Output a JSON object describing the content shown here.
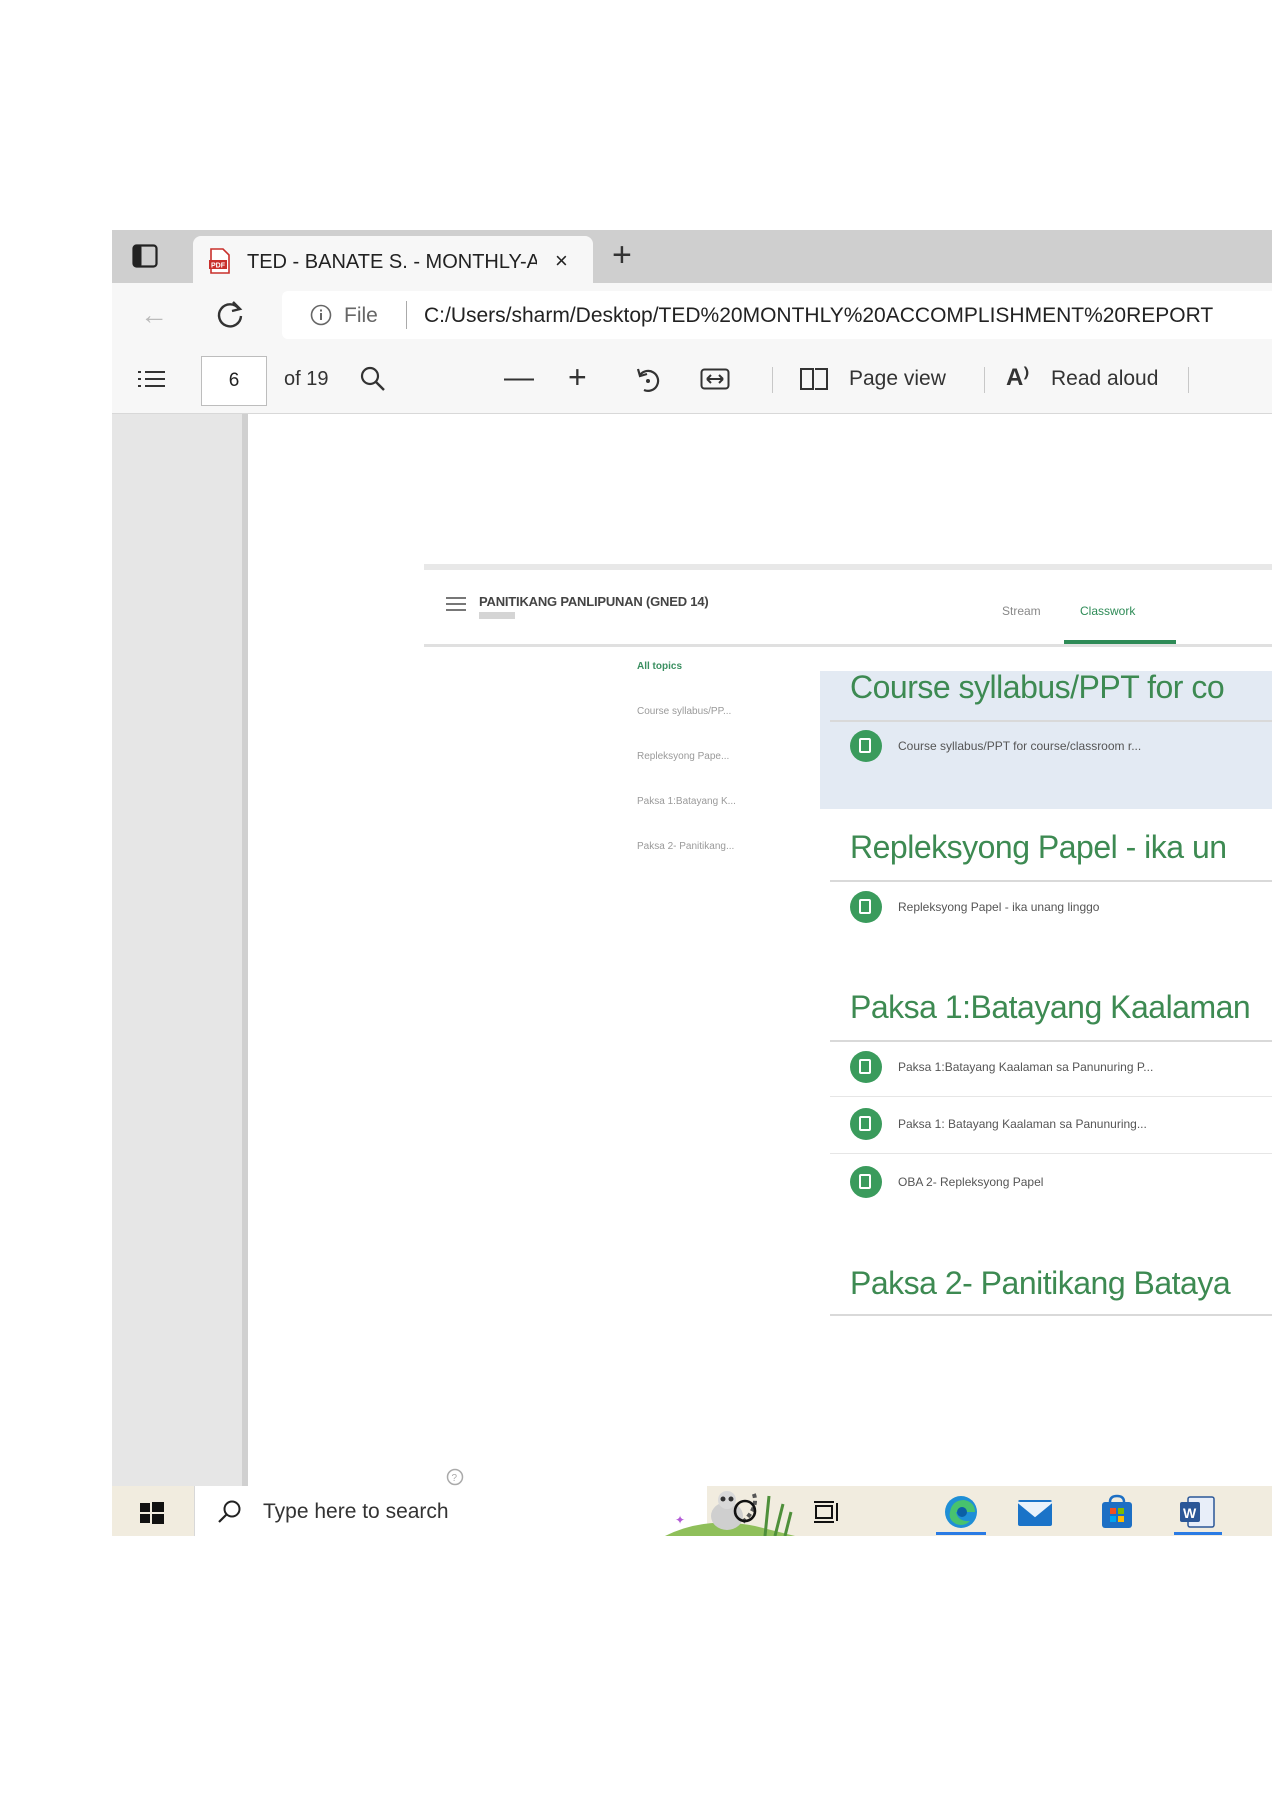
{
  "browser": {
    "tab_title": "TED - BANATE S. - MONTHLY-AC",
    "new_tab_symbol": "+",
    "close_symbol": "×",
    "address": {
      "scheme_label": "File",
      "url": "C:/Users/sharm/Desktop/TED%20MONTHLY%20ACCOMPLISHMENT%20REPORT"
    }
  },
  "pdf_toolbar": {
    "page_number": "6",
    "page_count": "of 19",
    "zoom_out_symbol": "—",
    "zoom_in_symbol": "+",
    "page_view_label": "Page view",
    "read_aloud_icon": "A⁾",
    "read_aloud_label": "Read aloud"
  },
  "classroom": {
    "course_title": "PANITIKANG PANLIPUNAN (GNED 14)",
    "tabs": {
      "stream": "Stream",
      "classwork": "Classwork"
    },
    "topics": [
      "All topics",
      "Course syllabus/PP...",
      "Repleksyong Pape...",
      "Paksa 1:Batayang K...",
      "Paksa 2- Panitikang..."
    ],
    "sections": [
      {
        "title": "Course syllabus/PPT for co",
        "items": [
          "Course syllabus/PPT for course/classroom r..."
        ]
      },
      {
        "title": "Repleksyong Papel - ika un",
        "items": [
          "Repleksyong Papel - ika unang linggo"
        ]
      },
      {
        "title": "Paksa 1:Batayang Kaalaman",
        "items": [
          "Paksa 1:Batayang Kaalaman sa Panunuring P...",
          "Paksa 1: Batayang Kaalaman sa Panunuring...",
          "OBA 2- Repleksyong Papel"
        ]
      },
      {
        "title": "Paksa 2- Panitikang Bataya",
        "items": []
      }
    ]
  },
  "taskbar": {
    "search_placeholder": "Type here to search",
    "apps": [
      "edge-icon",
      "mail-icon",
      "store-icon",
      "word-icon"
    ]
  },
  "colors": {
    "classroom_green": "#3d8a52",
    "highlight_blue": "#e3eaf3",
    "taskbar": "#f1ecdf",
    "tab_strip": "#cfcfcf"
  }
}
